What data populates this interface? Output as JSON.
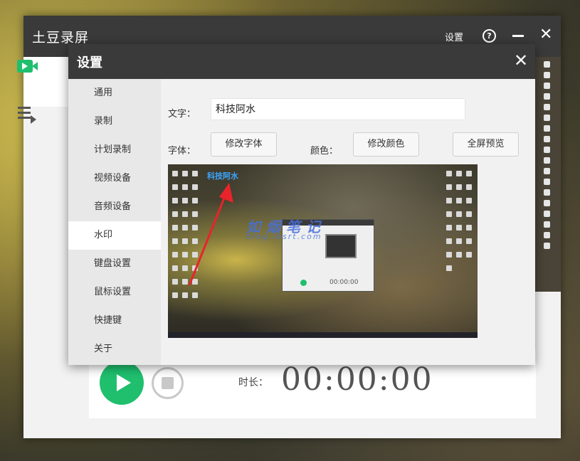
{
  "app": {
    "title": "土豆录屏",
    "settings_link": "设置",
    "help_glyph": "?",
    "close_glyph": "✕",
    "duration_label": "时长：",
    "duration_value": "00:00:00"
  },
  "dialog": {
    "title": "设置",
    "close_glyph": "✕",
    "sidebar": {
      "active_index": 5,
      "items": [
        {
          "label": "通用"
        },
        {
          "label": "录制"
        },
        {
          "label": "计划录制"
        },
        {
          "label": "视频设备"
        },
        {
          "label": "音频设备"
        },
        {
          "label": "水印"
        },
        {
          "label": "键盘设置"
        },
        {
          "label": "鼠标设置"
        },
        {
          "label": "快捷键"
        },
        {
          "label": "关于"
        }
      ]
    },
    "watermark": {
      "text_label": "文字：",
      "text_value": "科技阿水",
      "font_label": "字体：",
      "change_font_button": "修改字体",
      "color_label": "颜色：",
      "change_color_button": "修改颜色",
      "fullscreen_preview_button": "全屏预览",
      "preview": {
        "watermark_text": "科技阿水",
        "mini_timer": "00:00:00",
        "site_watermark": "如烟笔记",
        "site_url": "blog.iosrt.com"
      }
    }
  },
  "colors": {
    "titlebar": "#3a3a3a",
    "accent_green": "#1fbf6e",
    "watermark_blue": "#3aa6ff"
  },
  "icons": [
    "video-camera-icon",
    "playlist-icon",
    "help-icon",
    "minimize-icon",
    "close-icon",
    "play-icon",
    "stop-icon"
  ]
}
